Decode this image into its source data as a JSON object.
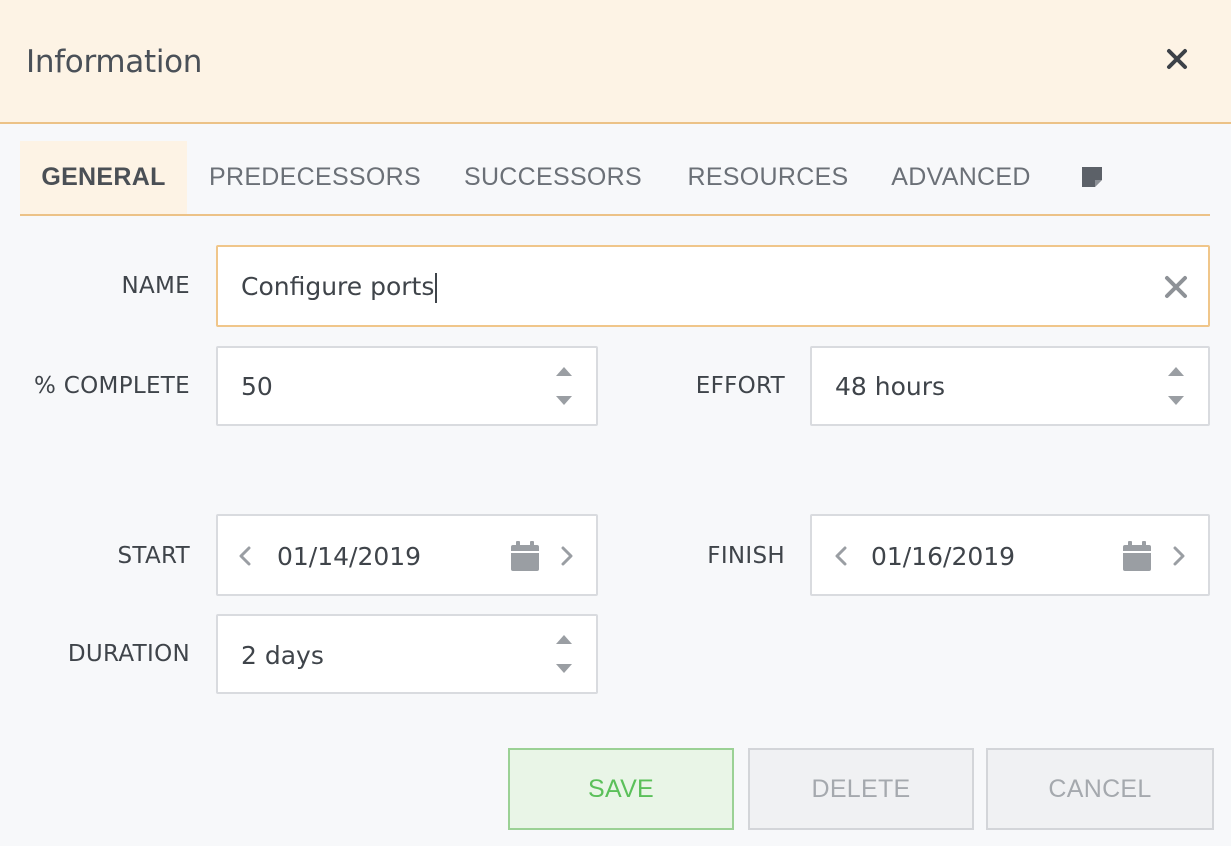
{
  "dialog": {
    "title": "Information"
  },
  "tabs": [
    {
      "label": "GENERAL",
      "active": true
    },
    {
      "label": "PREDECESSORS",
      "active": false
    },
    {
      "label": "SUCCESSORS",
      "active": false
    },
    {
      "label": "RESOURCES",
      "active": false
    },
    {
      "label": "ADVANCED",
      "active": false
    }
  ],
  "form": {
    "name": {
      "label": "NAME",
      "value": "Configure ports"
    },
    "percent_complete": {
      "label": "% COMPLETE",
      "value": "50"
    },
    "effort": {
      "label": "EFFORT",
      "value": "48 hours"
    },
    "start": {
      "label": "START",
      "value": "01/14/2019"
    },
    "finish": {
      "label": "FINISH",
      "value": "01/16/2019"
    },
    "duration": {
      "label": "DURATION",
      "value": "2 days"
    }
  },
  "buttons": {
    "save": "SAVE",
    "delete": "DELETE",
    "cancel": "CANCEL"
  },
  "icons": {
    "close": "close-icon",
    "notes": "note-icon",
    "clear": "clear-icon",
    "calendar": "calendar-icon",
    "spin_up": "chevron-up-icon",
    "spin_down": "chevron-down-icon",
    "prev": "chevron-left-icon",
    "next": "chevron-right-icon"
  },
  "colors": {
    "header_bg": "#fdf3e5",
    "accent_border": "#ecc287",
    "save_text": "#5bc05a",
    "save_bg": "#e9f5e7"
  }
}
